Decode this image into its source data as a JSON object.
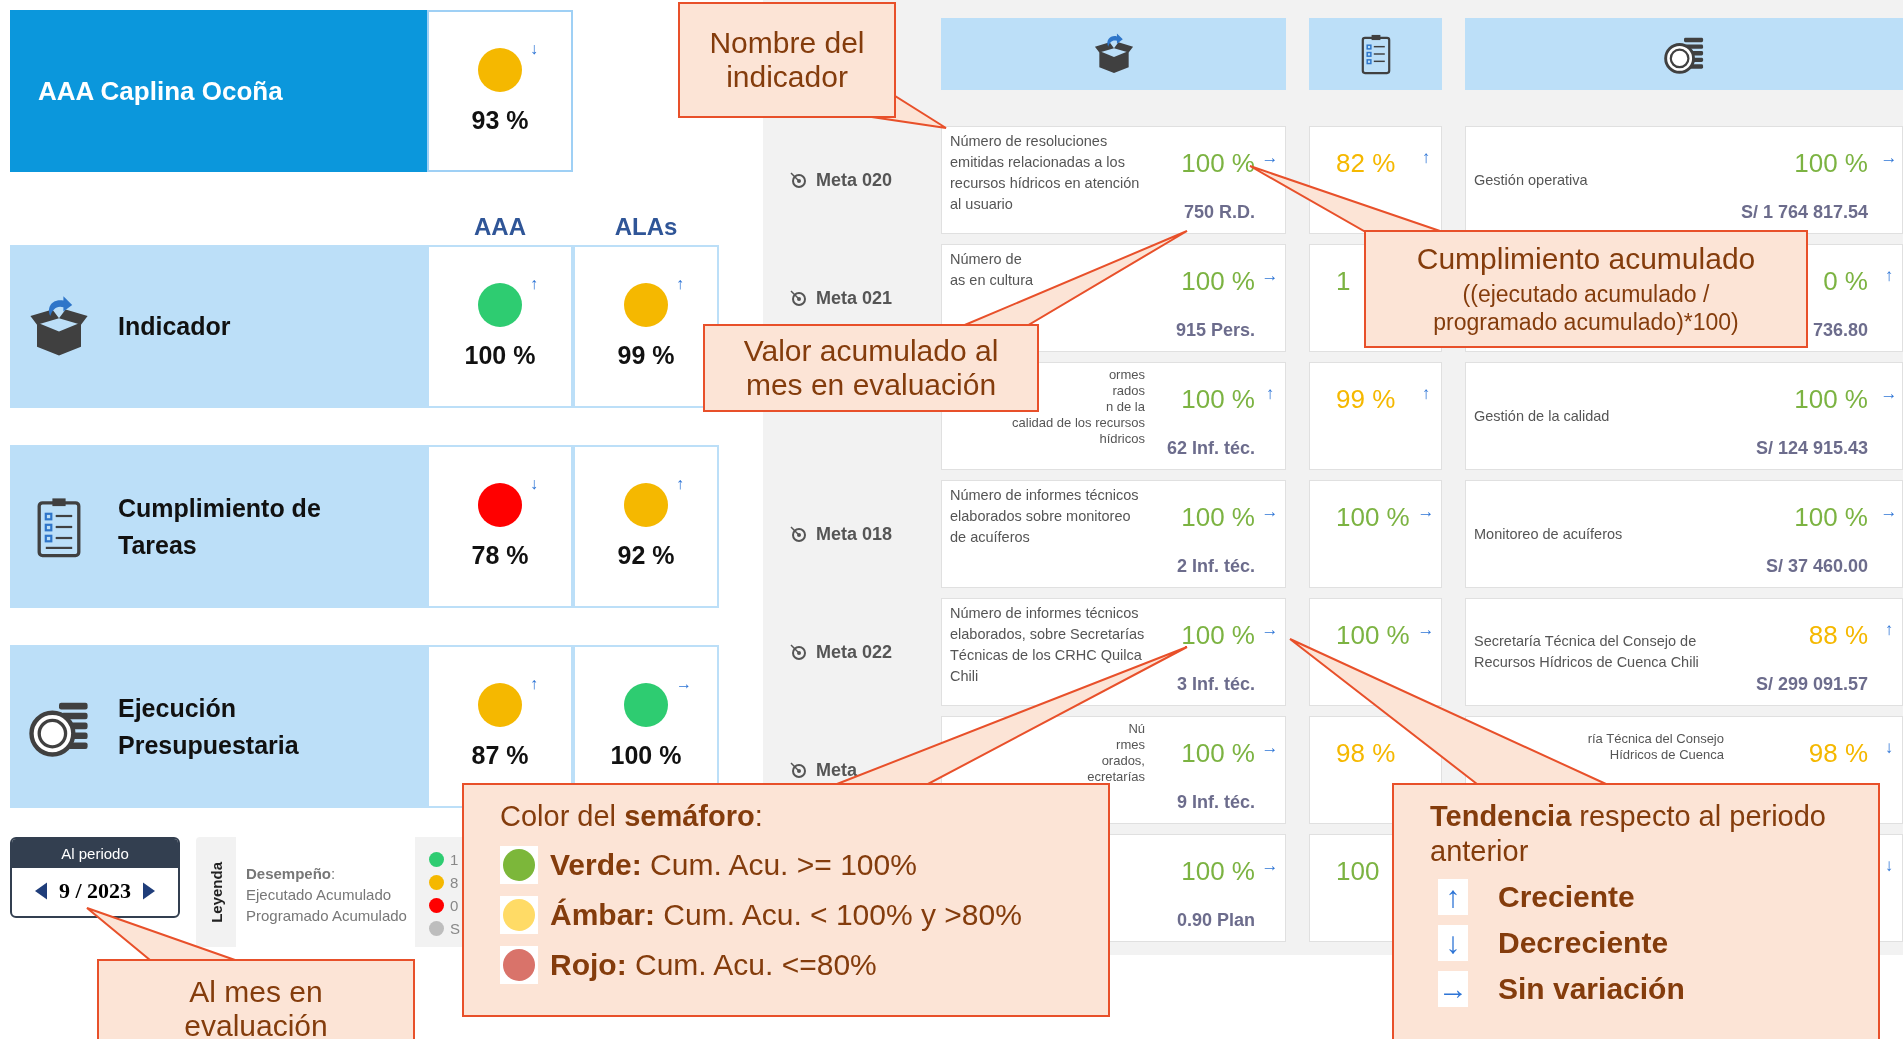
{
  "summary": {
    "title": "AAA Caplina Ocoña",
    "color": "#f5b800",
    "trend": "↓",
    "value": "93 %"
  },
  "column_headers": [
    "AAA",
    "ALAs"
  ],
  "categories": [
    {
      "kind": "box",
      "label": "Indicador",
      "cells": [
        {
          "color": "#2ecc71",
          "trend": "↑",
          "value": "100 %"
        },
        {
          "color": "#f5b800",
          "trend": "↑",
          "value": "99 %"
        }
      ]
    },
    {
      "kind": "clipboard",
      "label": "Cumplimiento de Tareas",
      "cells": [
        {
          "color": "#ff0000",
          "trend": "↓",
          "value": "78 %"
        },
        {
          "color": "#f5b800",
          "trend": "↑",
          "value": "92 %"
        }
      ]
    },
    {
      "kind": "coins",
      "label": "Ejecución Presupuestaria",
      "cells": [
        {
          "color": "#f5b800",
          "trend": "↑",
          "value": "87 %"
        },
        {
          "color": "#2ecc71",
          "trend": "→",
          "value": "100 %"
        }
      ]
    }
  ],
  "period": {
    "title": "Al periodo",
    "value": "9 / 2023"
  },
  "legend": {
    "title": "Leyenda",
    "heading": "**Desempeño**:",
    "lines": [
      "Ejecutado Acumulado",
      "Programado Acumulado"
    ],
    "items": [
      {
        "color": "#2ecc71",
        "text": "1"
      },
      {
        "color": "#f5b800",
        "text": "8"
      },
      {
        "color": "#ff0000",
        "text": "0"
      },
      {
        "color": "#bdbdbd",
        "text": "S"
      }
    ]
  },
  "indicator_headers": [
    {
      "kind": "box"
    },
    {
      "kind": "clipboard"
    },
    {
      "kind": "coins"
    }
  ],
  "metas": [
    {
      "meta": "Meta 020",
      "description": "Número de resoluciones emitidas relacionadas a los recursos hídricos en atención al usuario",
      "progress": {
        "value": "100 %",
        "color": "#7cb342",
        "trend": "→"
      },
      "amount": "750 R.D.",
      "monthly": {
        "value": "82 %",
        "color": "#f5b800",
        "trend": "↑"
      },
      "budget": {
        "description": "Gestión operativa",
        "value": "100 %",
        "color": "#7cb342",
        "trend": "→",
        "amount": "S/ 1 764 817.54"
      }
    },
    {
      "meta": "Meta 021",
      "description_lines": [
        "Número de",
        "as en cultura"
      ],
      "progress": {
        "value": "100 %",
        "color": "#7cb342",
        "trend": "→"
      },
      "amount": "915 Pers.",
      "monthly": {
        "value": "1",
        "color": "#7cb342"
      },
      "budget": {
        "value": "0 %",
        "color": "#7cb342",
        "trend": "↑",
        "amount": "736.80"
      }
    },
    {
      "fragments": [
        "ormes",
        "rados",
        "n de la",
        "calidad de los recursos",
        "hídricos"
      ],
      "progress": {
        "value": "100 %",
        "color": "#7cb342",
        "trend": "↑"
      },
      "amount": "62 Inf. téc.",
      "monthly": {
        "value": "99 %",
        "color": "#f5b800",
        "trend": "↑"
      },
      "budget": {
        "description": "Gestión de la calidad",
        "value": "100 %",
        "color": "#7cb342",
        "trend": "→",
        "amount": "S/ 124 915.43"
      }
    },
    {
      "meta": "Meta 018",
      "description": "Número de informes técnicos elaborados sobre monitoreo de acuíferos",
      "progress": {
        "value": "100 %",
        "color": "#7cb342",
        "trend": "→"
      },
      "amount": "2 Inf. téc.",
      "monthly": {
        "value": "100 %",
        "color": "#7cb342",
        "trend": "→"
      },
      "budget": {
        "description": "Monitoreo de acuíferos",
        "value": "100 %",
        "color": "#7cb342",
        "trend": "→",
        "amount": "S/ 37 460.00"
      }
    },
    {
      "meta": "Meta 022",
      "description": "Número de informes técnicos elaborados, sobre Secretarías Técnicas de los CRHC Quilca Chili",
      "progress": {
        "value": "100 %",
        "color": "#7cb342",
        "trend": "→"
      },
      "amount": "3 Inf. téc.",
      "monthly": {
        "value": "100 %",
        "color": "#7cb342",
        "trend": "→"
      },
      "budget": {
        "description": "Secretaría Técnica del Consejo de Recursos Hídricos de Cuenca Chili",
        "value": "88 %",
        "color": "#f5b800",
        "trend": "↑",
        "amount": "S/ 299 091.57"
      }
    },
    {
      "meta": "Meta",
      "fragments": [
        "Nú",
        "rmes",
        "orados,",
        "ecretarías"
      ],
      "progress": {
        "value": "100 %",
        "color": "#7cb342",
        "trend": "→"
      },
      "amount": "9 Inf. téc.",
      "monthly": {
        "value": "98 %",
        "color": "#f5b800"
      },
      "budget": {
        "fragments": [
          "ría Técnica del Consejo",
          "Hídricos de Cuenca"
        ],
        "value": "98 %",
        "color": "#f5b800",
        "trend": "↓"
      }
    },
    {
      "progress": {
        "value": "100 %",
        "color": "#7cb342",
        "trend": "→"
      },
      "amount": "0.90 Plan",
      "monthly": {
        "value": "100",
        "color": "#7cb342"
      },
      "budget": {
        "trend": "↓"
      }
    }
  ],
  "callouts": [
    {
      "kind": "plain",
      "title": "Nombre del indicador"
    },
    {
      "kind": "formula",
      "title": "Cumplimiento acumulado",
      "subtitle": "((ejecutado acumulado / programado acumulado)*100)"
    },
    {
      "kind": "plain",
      "title": "Valor acumulado al mes en evaluación"
    },
    {
      "kind": "plain",
      "title": "Al mes en evaluación"
    },
    {
      "kind": "colors",
      "title": "Color del **semáforo**:",
      "items": [
        {
          "color": "#7cb73a",
          "text": "**Verde:** Cum. Acu. >= 100%"
        },
        {
          "color": "#ffdb66",
          "text": "**Ámbar:** Cum. Acu. < 100% y >80%"
        },
        {
          "color": "#d9736a",
          "text": "**Rojo:** Cum. Acu. <=80%"
        }
      ]
    },
    {
      "kind": "trends",
      "title": "**Tendencia** respecto al periodo anterior",
      "items": [
        {
          "arrow": "↑",
          "text": "Creciente"
        },
        {
          "arrow": "↓",
          "text": "Decreciente"
        },
        {
          "arrow": "→",
          "text": "Sin variación"
        }
      ]
    }
  ]
}
